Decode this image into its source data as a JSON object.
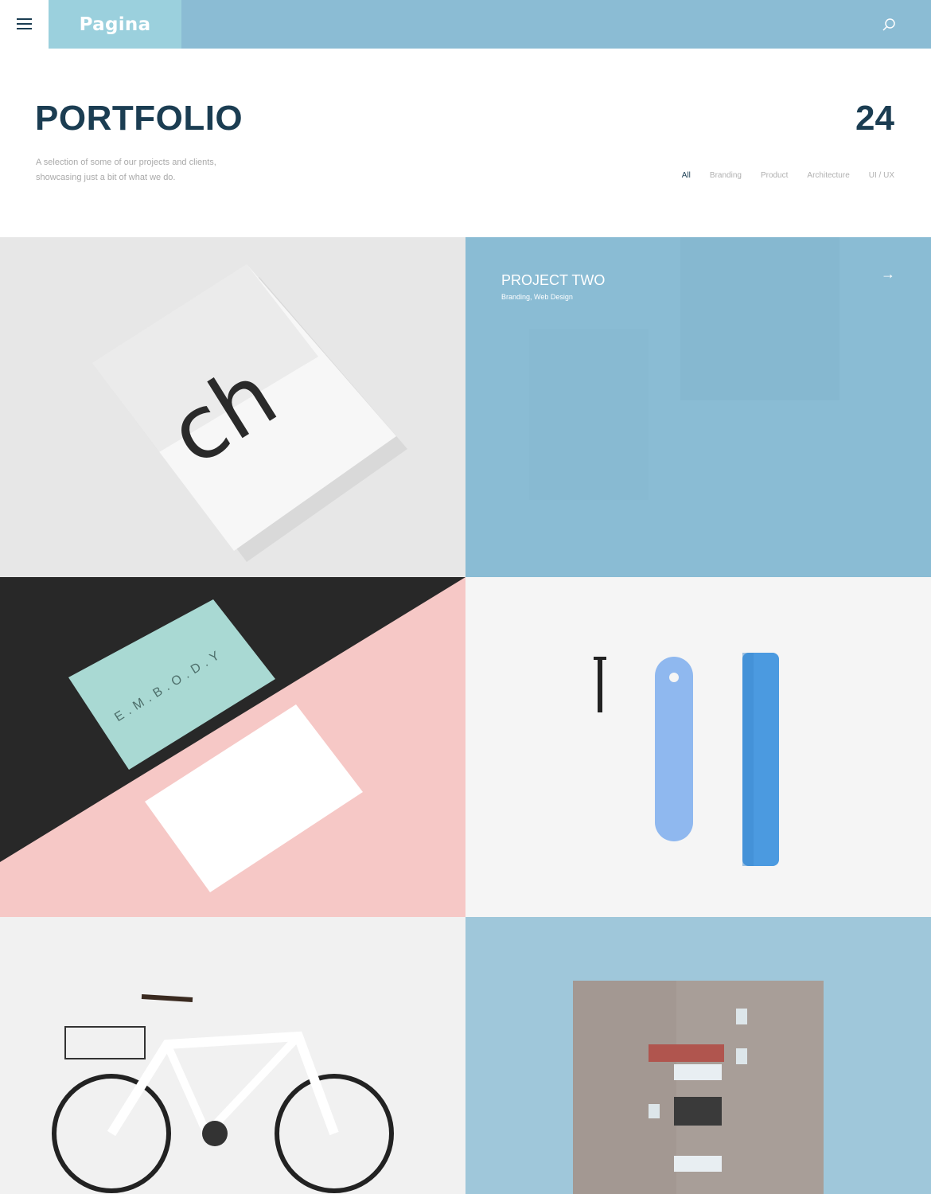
{
  "header": {
    "logo": "Pagina",
    "menu_icon": "hamburger-icon",
    "search_icon": "search-icon",
    "colors": {
      "bar": "#8bbcd4",
      "logo_bg": "#9bd0dd"
    }
  },
  "intro": {
    "title": "PORTFOLIO",
    "count": "24",
    "description": "A selection of some of our projects and clients, showcasing just a bit of what we do."
  },
  "filters": [
    {
      "label": "All",
      "active": true
    },
    {
      "label": "Branding"
    },
    {
      "label": "Product"
    },
    {
      "label": "Architecture"
    },
    {
      "label": "UI / UX"
    }
  ],
  "projects": [
    {
      "image": "letterhead-mockup",
      "image_text": "ch"
    },
    {
      "title": "PROJECT TWO",
      "categories": "Branding, Web Design",
      "arrow_icon": "arrow-right-icon"
    },
    {
      "image": "business-cards-mockup",
      "image_text": "E.M.B.O.D.Y"
    },
    {
      "image": "screw-strap-tube-product"
    },
    {
      "image": "white-bicycle"
    },
    {
      "image": "apartment-building"
    }
  ]
}
